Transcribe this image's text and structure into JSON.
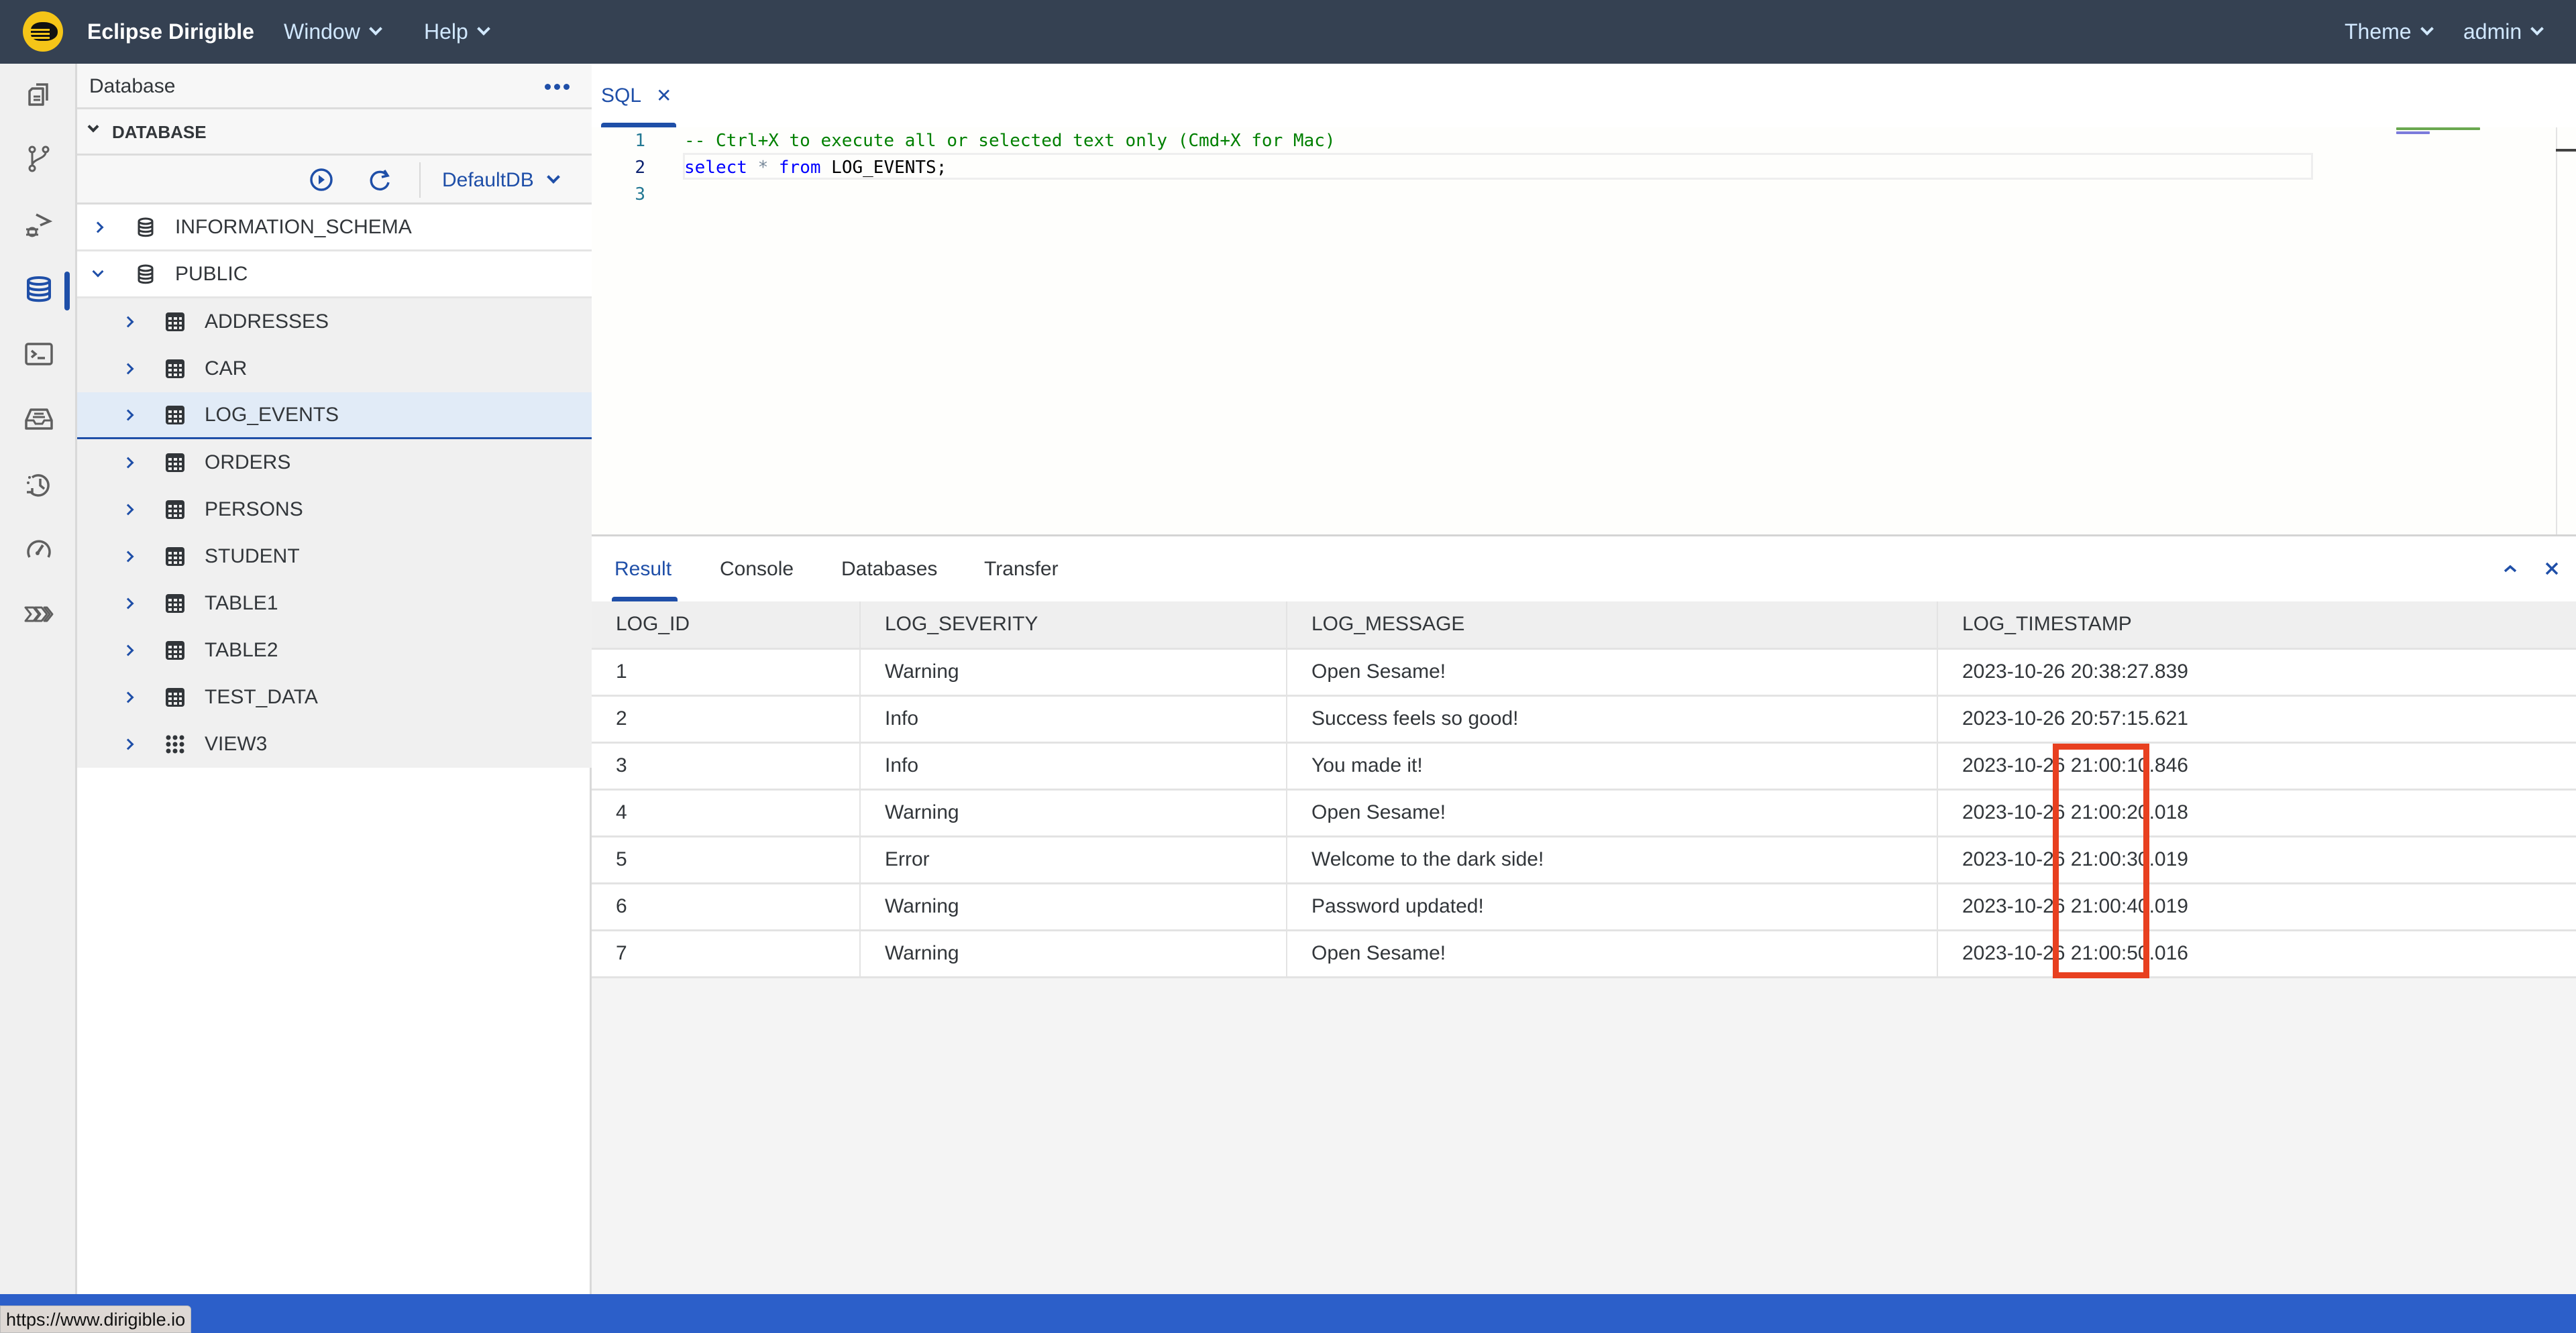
{
  "app": {
    "title": "Eclipse Dirigible",
    "logo_icon": "dirigible-logo-icon"
  },
  "shellbar": {
    "menus": [
      {
        "label": "Window",
        "icon": "chevron-down-icon"
      },
      {
        "label": "Help",
        "icon": "chevron-down-icon"
      }
    ],
    "right_menus": [
      {
        "label": "Theme",
        "icon": "chevron-down-icon"
      },
      {
        "label": "admin",
        "icon": "chevron-down-icon"
      }
    ]
  },
  "activity_bar": {
    "items": [
      {
        "name": "projects",
        "icon": "files-icon",
        "active": false
      },
      {
        "name": "git",
        "icon": "git-branch-icon",
        "active": false
      },
      {
        "name": "debugger",
        "icon": "debug-icon",
        "active": false
      },
      {
        "name": "database",
        "icon": "database-icon",
        "active": true
      },
      {
        "name": "terminal",
        "icon": "terminal-icon",
        "active": false
      },
      {
        "name": "repository",
        "icon": "inbox-icon",
        "active": false
      },
      {
        "name": "jobs",
        "icon": "history-icon",
        "active": false
      },
      {
        "name": "operations",
        "icon": "speedometer-icon",
        "active": false
      },
      {
        "name": "transport",
        "icon": "process-icon",
        "active": false
      }
    ]
  },
  "sidebar": {
    "title": "Database",
    "more_icon": "more-horizontal-icon",
    "section_label": "DATABASE",
    "toolbar": {
      "run_icon": "play-circle-icon",
      "refresh_icon": "refresh-icon",
      "datasource": "DefaultDB"
    },
    "tree": [
      {
        "label": "INFORMATION_SCHEMA",
        "type": "schema",
        "expanded": false
      },
      {
        "label": "PUBLIC",
        "type": "schema",
        "expanded": true,
        "children": [
          {
            "label": "ADDRESSES",
            "type": "table",
            "selected": false
          },
          {
            "label": "CAR",
            "type": "table",
            "selected": false
          },
          {
            "label": "LOG_EVENTS",
            "type": "table",
            "selected": true
          },
          {
            "label": "ORDERS",
            "type": "table",
            "selected": false
          },
          {
            "label": "PERSONS",
            "type": "table",
            "selected": false
          },
          {
            "label": "STUDENT",
            "type": "table",
            "selected": false
          },
          {
            "label": "TABLE1",
            "type": "table",
            "selected": false
          },
          {
            "label": "TABLE2",
            "type": "table",
            "selected": false
          },
          {
            "label": "TEST_DATA",
            "type": "table",
            "selected": false
          },
          {
            "label": "VIEW3",
            "type": "view",
            "selected": false
          }
        ]
      }
    ]
  },
  "editor": {
    "tab_label": "SQL",
    "close_icon": "close-icon",
    "lines": [
      {
        "number": "1",
        "comment": "-- Ctrl+X to execute all or selected text only (Cmd+X for Mac)"
      },
      {
        "number": "2",
        "kw1": "select",
        "op": "*",
        "kw2": "from",
        "ident": "LOG_EVENTS;"
      },
      {
        "number": "3"
      }
    ]
  },
  "result_panel": {
    "tabs": [
      "Result",
      "Console",
      "Databases",
      "Transfer"
    ],
    "active_tab": "Result",
    "controls": {
      "collapse_icon": "chevron-up-icon",
      "close_icon": "close-icon"
    },
    "columns": [
      "LOG_ID",
      "LOG_SEVERITY",
      "LOG_MESSAGE",
      "LOG_TIMESTAMP"
    ],
    "rows": [
      [
        "1",
        "Warning",
        "Open Sesame!",
        "2023-10-26 20:38:27.839"
      ],
      [
        "2",
        "Info",
        "Success feels so good!",
        "2023-10-26 20:57:15.621"
      ],
      [
        "3",
        "Info",
        "You made it!",
        "2023-10-26 21:00:10.846"
      ],
      [
        "4",
        "Warning",
        "Open Sesame!",
        "2023-10-26 21:00:20.018"
      ],
      [
        "5",
        "Error",
        "Welcome to the dark side!",
        "2023-10-26 21:00:30.019"
      ],
      [
        "6",
        "Warning",
        "Password updated!",
        "2023-10-26 21:00:40.019"
      ],
      [
        "7",
        "Warning",
        "Open Sesame!",
        "2023-10-26 21:00:50.016"
      ]
    ],
    "highlight_annotation": {
      "color": "#e84020",
      "rows": [
        3,
        4,
        5,
        6,
        7
      ],
      "column": "LOG_TIMESTAMP",
      "portion": "time hh:mm:ss"
    }
  },
  "statusbar": {
    "url_tooltip": "https://www.dirigible.io"
  },
  "colors": {
    "shellbar": "#354152",
    "accent": "#1f4fa8",
    "statusbar": "#2c5fc9",
    "selection": "#e1ebf7",
    "annotation": "#e84020"
  }
}
